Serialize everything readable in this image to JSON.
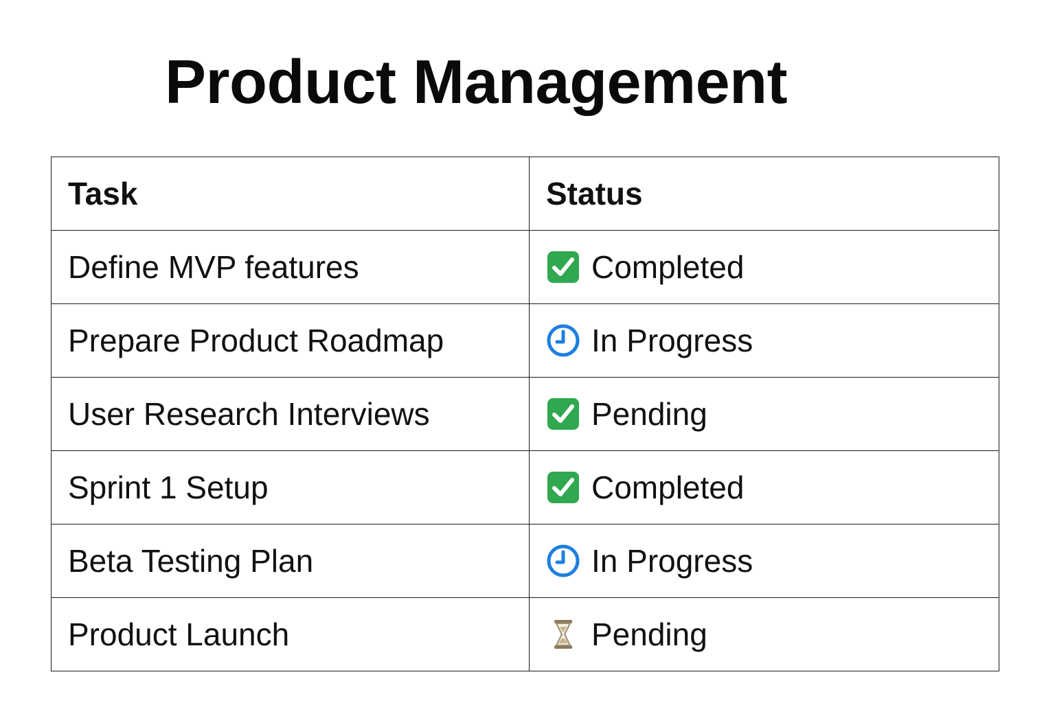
{
  "title": "Product Management",
  "table": {
    "headers": [
      "Task",
      "Status"
    ],
    "rows": [
      {
        "task": "Define MVP features",
        "status": "Completed",
        "icon": "check-mark-icon"
      },
      {
        "task": "Prepare Product Roadmap",
        "status": "In Progress",
        "icon": "clock-icon"
      },
      {
        "task": "User Research Interviews",
        "status": "Pending",
        "icon": "check-mark-icon"
      },
      {
        "task": "Sprint 1 Setup",
        "status": "Completed",
        "icon": "check-mark-icon"
      },
      {
        "task": "Beta Testing Plan",
        "status": "In Progress",
        "icon": "clock-icon"
      },
      {
        "task": "Product Launch",
        "status": "Pending",
        "icon": "hourglass-icon"
      }
    ]
  },
  "colors": {
    "check_green": "#2fa84f",
    "clock_blue": "#1e7fe0",
    "hourglass_gold": "#c8b58a"
  }
}
